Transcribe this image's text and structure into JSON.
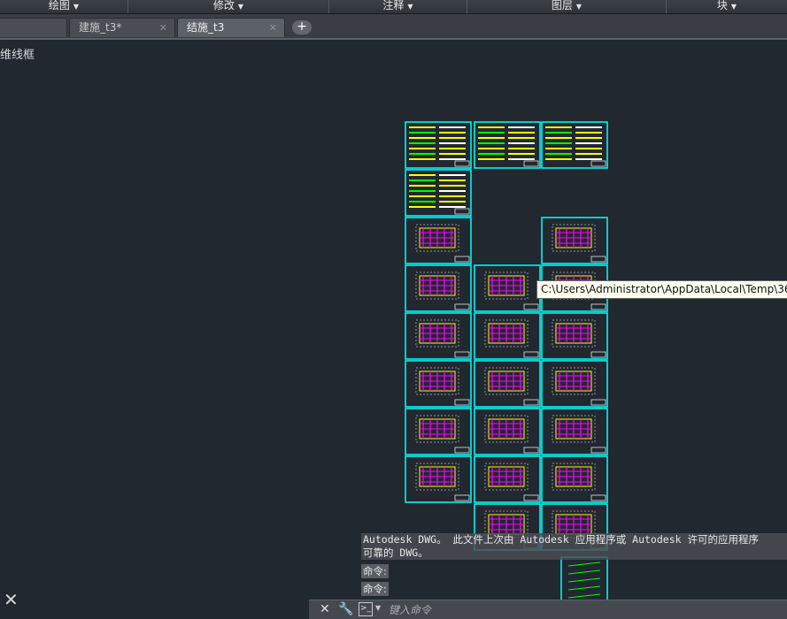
{
  "ribbon": {
    "panels": [
      {
        "label": "绘图"
      },
      {
        "label": "修改"
      },
      {
        "label": "注释"
      },
      {
        "label": "图层"
      },
      {
        "label": "块"
      }
    ]
  },
  "tabs": [
    {
      "label": "建施_t3*",
      "active": false
    },
    {
      "label": "结施_t3",
      "active": true
    }
  ],
  "new_tab_glyph": "+",
  "viewport": {
    "label": "维线框"
  },
  "tooltip": {
    "text": "C:\\Users\\Administrator\\AppData\\Local\\Temp\\36"
  },
  "command_history": [
    "Autodesk DWG。  此文件上次由 Autodesk 应用程序或 Autodesk 许可的应用程序",
    "可靠的 DWG。"
  ],
  "command_prompts": [
    "命令:",
    "命令:"
  ],
  "command_bar": {
    "placeholder": "键入命令",
    "icons": [
      "close-icon",
      "wrench-icon",
      "prompt-icon",
      "dropdown-arrow-icon"
    ]
  },
  "colors": {
    "background": "#212830",
    "sheet_border": "#00ffff",
    "content_magenta": "#ff00ff",
    "content_yellow": "#ffff00",
    "content_green": "#00ff00"
  }
}
